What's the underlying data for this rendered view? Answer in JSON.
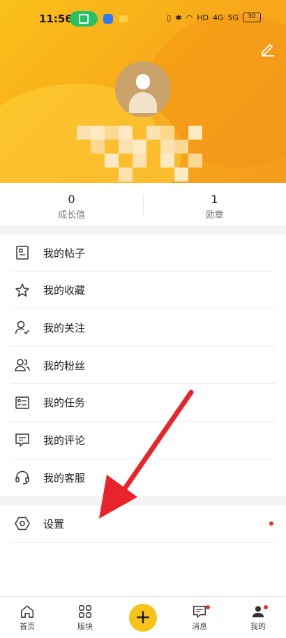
{
  "status_bar": {
    "time": "11:56",
    "network_label": "HD",
    "signal_a": "4G",
    "signal_b": "5G",
    "battery": "30"
  },
  "header": {
    "edit_icon": "pencil-icon",
    "avatar_icon": "user-avatar"
  },
  "stats": [
    {
      "value": "0",
      "label": "成长值"
    },
    {
      "value": "1",
      "label": "勋章"
    }
  ],
  "menu": {
    "items": [
      {
        "label": "我的帖子",
        "icon": "document-icon"
      },
      {
        "label": "我的收藏",
        "icon": "star-icon"
      },
      {
        "label": "我的关注",
        "icon": "user-check-icon"
      },
      {
        "label": "我的粉丝",
        "icon": "users-icon"
      },
      {
        "label": "我的任务",
        "icon": "checklist-icon"
      },
      {
        "label": "我的评论",
        "icon": "comment-icon"
      },
      {
        "label": "我的客服",
        "icon": "headset-icon"
      }
    ],
    "settings": {
      "label": "设置",
      "icon": "hexagon-gear-icon",
      "has_badge": true
    }
  },
  "bottom_nav": [
    {
      "label": "首页",
      "icon": "home-icon"
    },
    {
      "label": "版块",
      "icon": "grid-icon"
    },
    {
      "label": "",
      "icon": "plus-icon"
    },
    {
      "label": "消息",
      "icon": "message-icon",
      "badge": true
    },
    {
      "label": "我的",
      "icon": "profile-icon",
      "badge": true
    }
  ],
  "colors": {
    "accent": "#f7c319",
    "header": "#f8a81a",
    "badge": "#e5312a",
    "arrow": "#e8242a"
  }
}
